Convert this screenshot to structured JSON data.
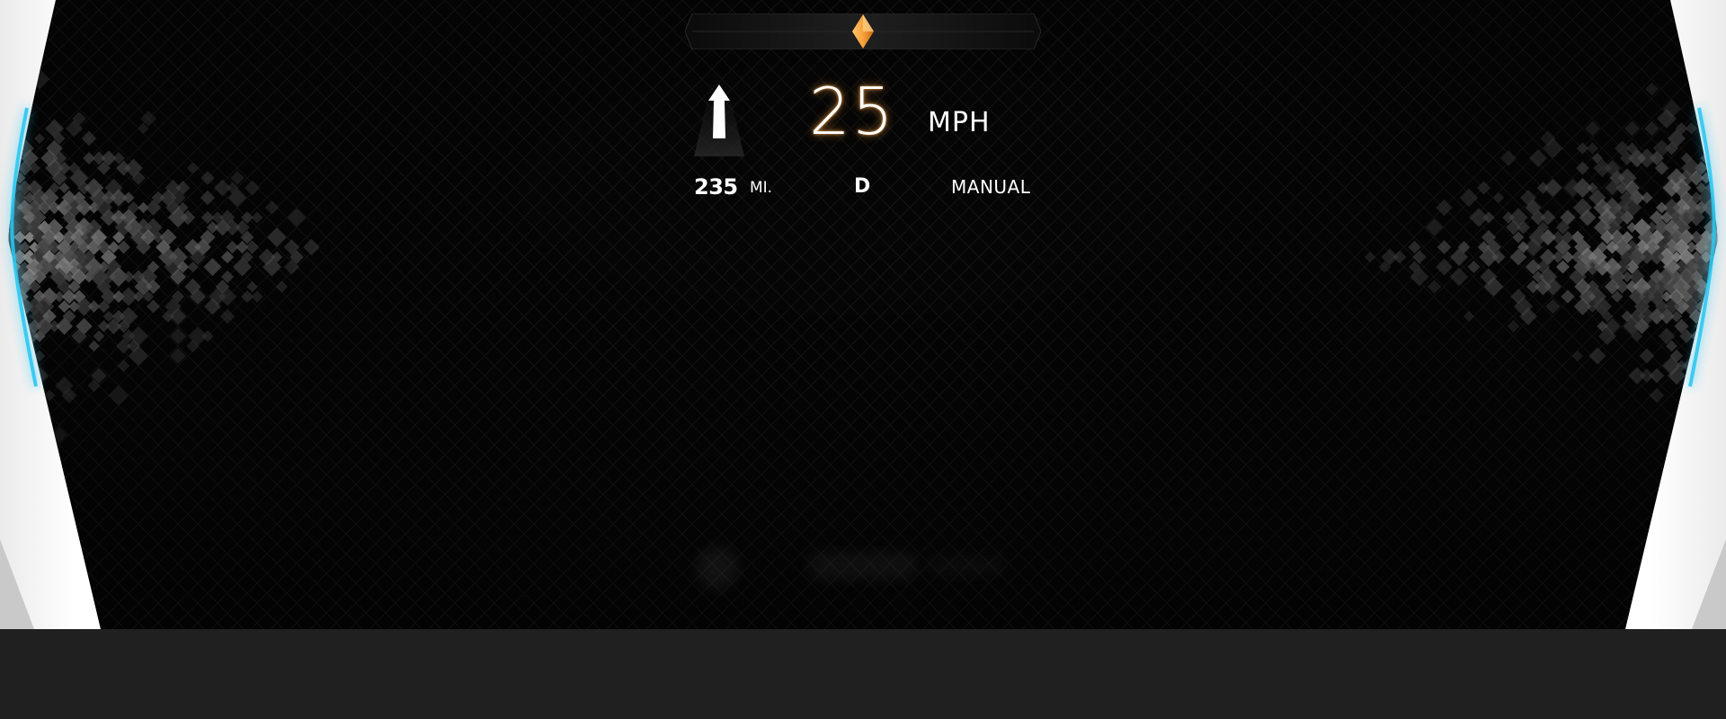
{
  "heading_indicator": {
    "marker_color": "#F7A23B"
  },
  "navigation": {
    "direction_icon": "straight-arrow-icon"
  },
  "speed": {
    "value": "25",
    "unit": "MPH",
    "glow_color": "#FF9A3C"
  },
  "status_row": {
    "range_value": "235",
    "range_unit": "MI.",
    "gear": "D",
    "drive_mode": "MANUAL"
  },
  "theme": {
    "screen_background": "#050505",
    "bezel_color": "#FFFFFF",
    "edge_glow": "#29C6F2",
    "bottom_bar": "#202020"
  }
}
